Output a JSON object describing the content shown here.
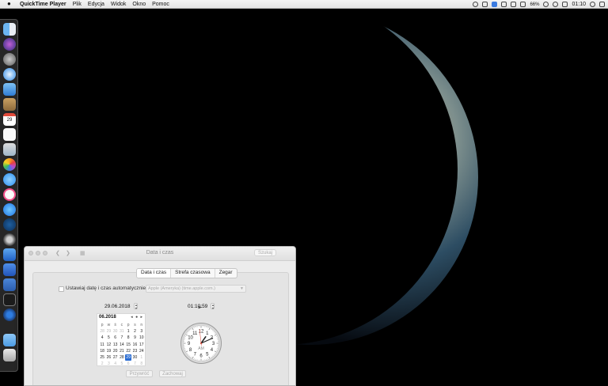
{
  "menubar": {
    "app_name": "QuickTime Player",
    "menus": [
      "Plik",
      "Edycja",
      "Widok",
      "Okno",
      "Pomoc"
    ],
    "battery": "66%",
    "clock": "01:10"
  },
  "window": {
    "title": "Data i czas",
    "search_placeholder": "Szukaj",
    "tabs": [
      "Data i czas",
      "Strefa czasowa",
      "Zegar"
    ],
    "active_tab": 0,
    "auto_checkbox_label": "Ustawiaj datę i czas automatycznie:",
    "auto_checkbox_checked": false,
    "time_server": "Apple (Ameryka) (time.apple.com.)",
    "date_value": "29.06.2018",
    "time_value": "01:10:59",
    "calendar": {
      "month_label": "06.2018",
      "nav": "◂ ● ▸",
      "weekdays": [
        "p",
        "w",
        "ś",
        "c",
        "p",
        "s",
        "n"
      ],
      "weeks": [
        [
          "28",
          "29",
          "30",
          "31",
          "1",
          "2",
          "3"
        ],
        [
          "4",
          "5",
          "6",
          "7",
          "8",
          "9",
          "10"
        ],
        [
          "11",
          "12",
          "13",
          "14",
          "15",
          "16",
          "17"
        ],
        [
          "18",
          "19",
          "20",
          "21",
          "22",
          "23",
          "24"
        ],
        [
          "25",
          "26",
          "27",
          "28",
          "29",
          "30",
          "1"
        ],
        [
          "2",
          "3",
          "4",
          "5",
          "6",
          "7",
          "8"
        ]
      ],
      "selected_day": "29"
    },
    "clock": {
      "numbers": [
        "12",
        "1",
        "2",
        "3",
        "4",
        "5",
        "6",
        "7",
        "8",
        "9",
        "10",
        "11"
      ],
      "ampm": "AM",
      "hour": 1,
      "minute": 10,
      "second": 59
    },
    "revert_label": "Przywróć",
    "save_label": "Zachowaj"
  },
  "dock": {
    "icons": [
      "finder-icon",
      "siri-icon",
      "launchpad-icon",
      "safari-icon",
      "mail-icon",
      "notes-icon",
      "calendar-icon",
      "reminders-icon",
      "preview-icon",
      "photos-icon",
      "messages-icon",
      "itunes-icon",
      "app-store-icon",
      "system-preferences-icon",
      "quicktime-icon",
      "xcode-icon",
      "terminal-icon",
      "chrome-icon",
      "downloads-icon",
      "trash-icon"
    ],
    "calendar_day": "29"
  },
  "colors": {
    "accent": "#2a6cd2",
    "window_bg": "#ececec",
    "menubar_bg": "#eeeeee"
  }
}
